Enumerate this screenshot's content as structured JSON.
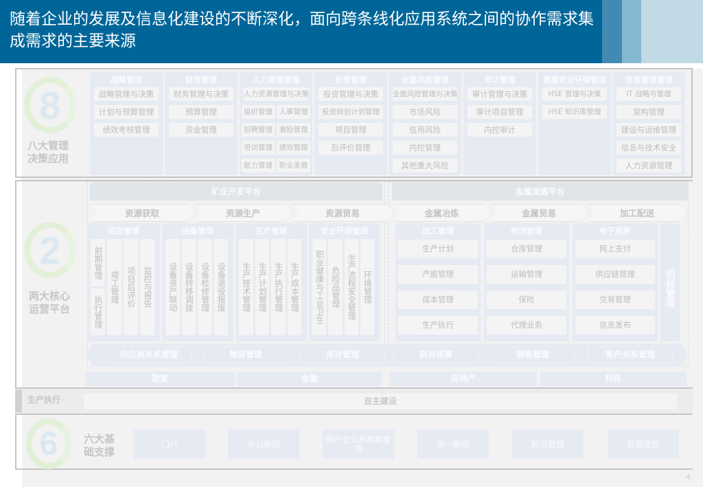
{
  "header": {
    "title": "随着企业的发展及信息化建设的不断深化，面向跨条线化应用系统之间的协作需求集成需求的主要来源",
    "colors": [
      "#006699",
      "#4289b3",
      "#84b8d0",
      "#c2d9e6"
    ]
  },
  "section8": {
    "number": "8",
    "label": "八大管理决策应用",
    "columns": [
      {
        "title": "战略管理",
        "items": [
          "战略管理与决策",
          "计划与预算管理",
          "绩效考核管理"
        ]
      },
      {
        "title": "财务管理",
        "items": [
          "财务管理与决策",
          "预算管理",
          "资金管理"
        ]
      },
      {
        "title": "人力资源管理",
        "items": [
          "人力资源管理与决策"
        ],
        "pairs": [
          [
            "组织管理",
            "人事管理"
          ],
          [
            "招聘管理",
            "激励管理"
          ],
          [
            "培训管理",
            "绩效管理"
          ],
          [
            "能力管理",
            "职业发展"
          ]
        ]
      },
      {
        "title": "投资管理",
        "items": [
          "投资管理与决策",
          "投资规划计划管理",
          "项目管理",
          "后评价管理"
        ]
      },
      {
        "title": "全面风险管理",
        "items": [
          "全面风险管理与决策",
          "市场风险",
          "信用风险",
          "内控管理",
          "其他重大风险"
        ]
      },
      {
        "title": "审计管理",
        "items": [
          "审计管理与决策",
          "审计项目管理",
          "内控审计"
        ]
      },
      {
        "title": "健康安全环保管理",
        "items": [
          "HSE 管理与决策",
          "HSE 知识库管理"
        ]
      },
      {
        "title": "信息管理管理",
        "items": [
          "IT 战略与管理",
          "架构管理",
          "建设与运维管理",
          "信息与技术安全",
          "人力资源管理"
        ]
      }
    ]
  },
  "section2": {
    "number": "2",
    "label": "两大核心运营平台",
    "platforms": [
      "矿业开发平台",
      "金属流通平台"
    ],
    "chain": [
      "资源获取",
      "资源生产",
      "资源贸易",
      "金属冶炼",
      "金属贸易",
      "加工配送"
    ],
    "left_groups": [
      {
        "title": "项目管理",
        "cells": [
          "前期管理",
          "执行管理",
          "竣工管理",
          "项目后评价",
          "监控与报告"
        ]
      },
      {
        "title": "设备管理",
        "cells": [
          "设备资产联动",
          "设备转移调拨",
          "设备检修管理",
          "设备退役报废"
        ]
      },
      {
        "title": "生产管理",
        "cells": [
          "生产技术管理",
          "生产计划管理",
          "生产执行管理",
          "生产成本管理"
        ]
      },
      {
        "title": "安全环保管理",
        "cells": [
          "职业健康与工业卫生",
          "危险品管理",
          "生产流程安全管理",
          "环境管理"
        ]
      }
    ],
    "right_groups": [
      {
        "title": "加工管理",
        "items": [
          "生产计划",
          "产能管理",
          "成本管理",
          "生产执行"
        ]
      },
      {
        "title": "物流管理",
        "items": [
          "仓库管理",
          "运输管理",
          "保险",
          "代理业务"
        ]
      },
      {
        "title": "电子商务",
        "items": [
          "网上支付",
          "供应链管理",
          "交易管理",
          "信息发布"
        ]
      }
    ],
    "bidding": "招标管理",
    "shared": [
      "供应商关系管理",
      "物资管理",
      "库存管理",
      "财务核算",
      "销售管理",
      "客户关系管理"
    ],
    "industries": [
      "勘查",
      "金融",
      "房地产",
      "科技"
    ]
  },
  "execution": {
    "label": "生产执行",
    "value": "自主建设"
  },
  "section6": {
    "number": "6",
    "label": "六大基础支撑",
    "items": [
      "门户",
      "办公协同",
      "用户全生命周期管理",
      "统一集成",
      "知识管理",
      "数据管控"
    ]
  },
  "page_number": "4"
}
